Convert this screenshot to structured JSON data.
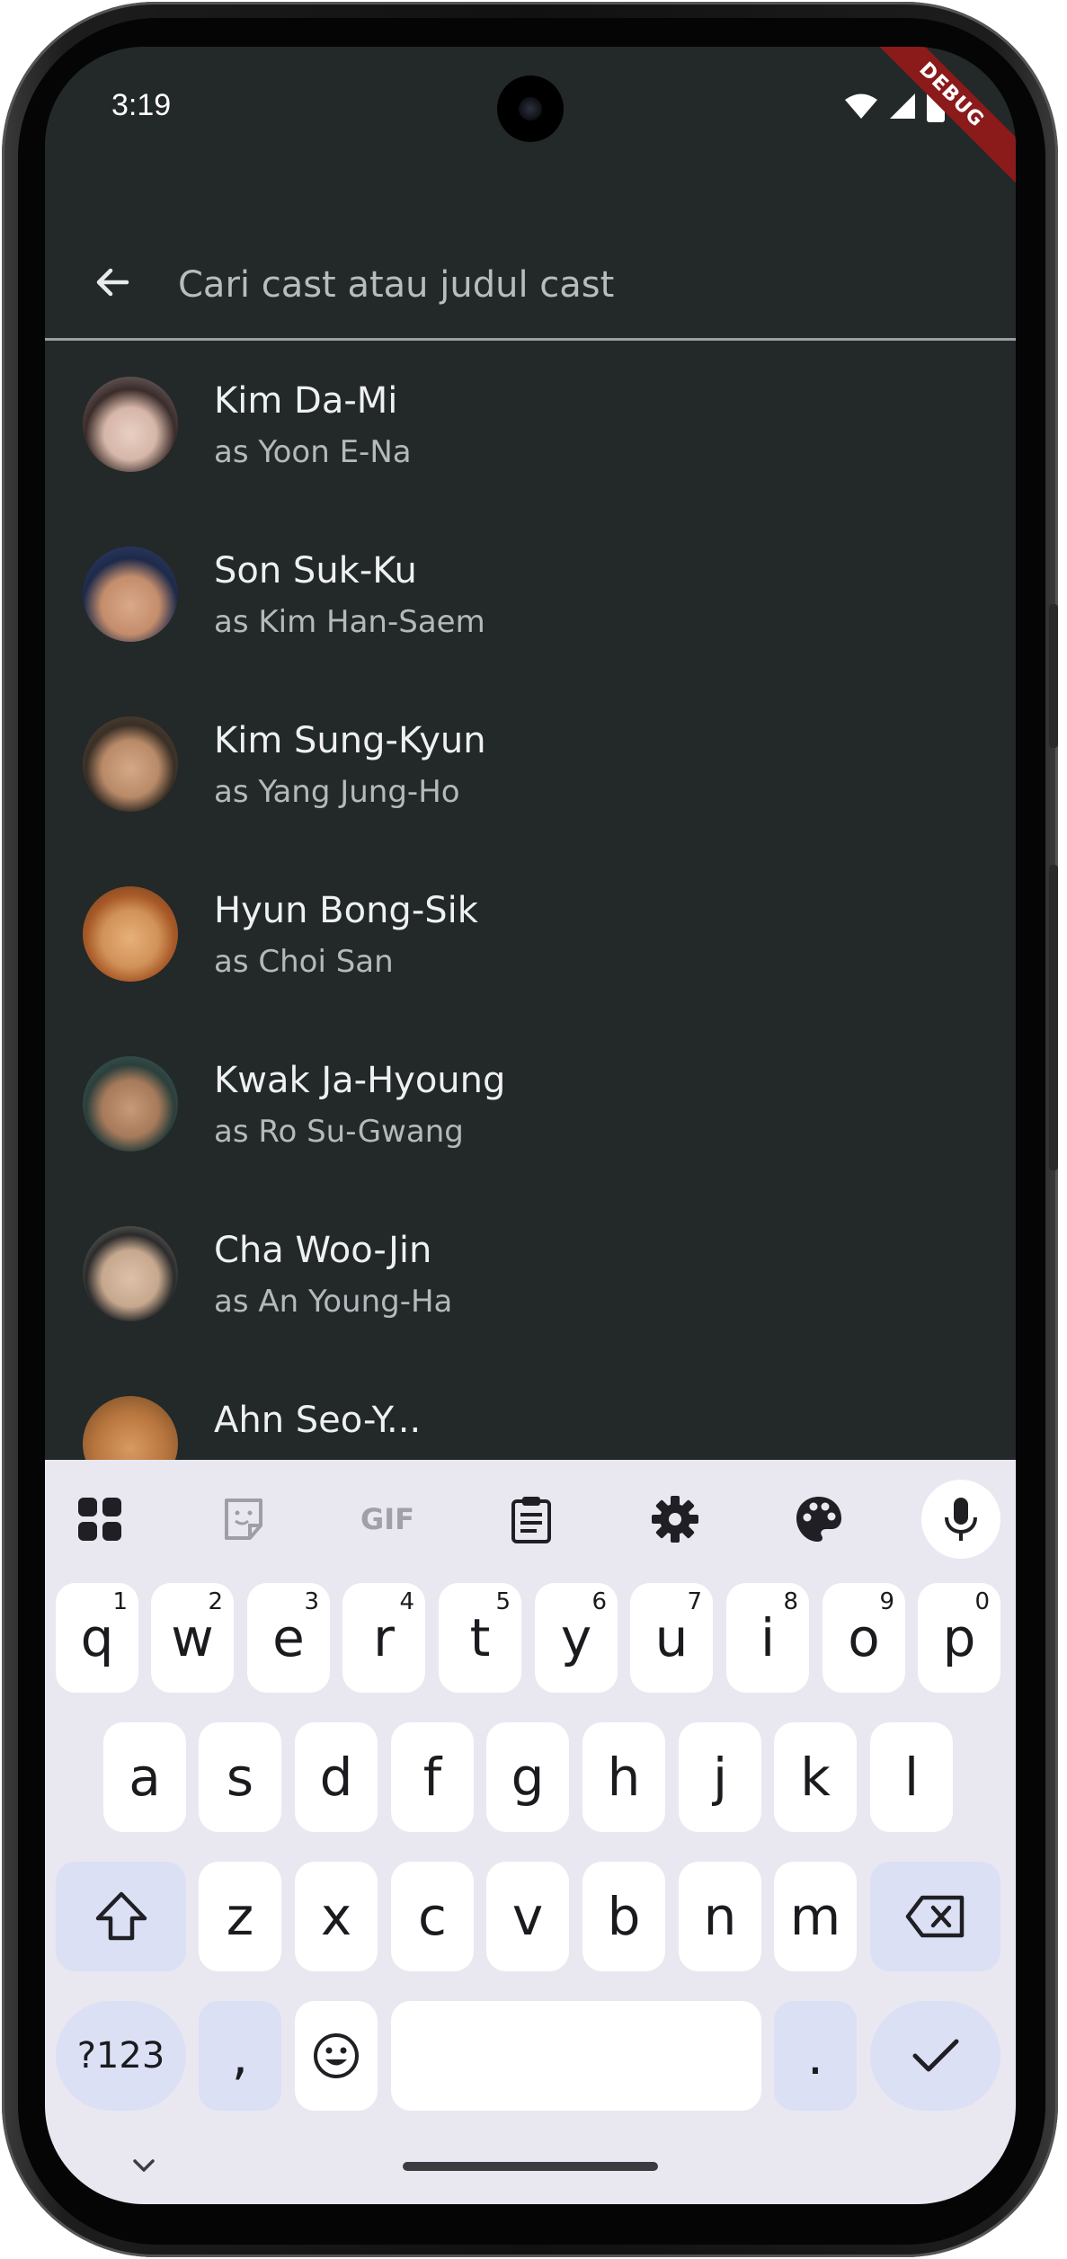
{
  "status_bar": {
    "time": "3:19",
    "icons": [
      "wifi-icon",
      "signal-icon",
      "battery-icon"
    ],
    "debug_label": "DEBUG"
  },
  "search": {
    "placeholder": "Cari cast atau judul cast",
    "value": ""
  },
  "cast": [
    {
      "name": "Kim Da-Mi",
      "role": "as Yoon E-Na",
      "avatar_color": "#6b5a55"
    },
    {
      "name": "Son Suk-Ku",
      "role": "as Kim Han-Saem",
      "avatar_color": "#2f3a57"
    },
    {
      "name": "Kim Sung-Kyun",
      "role": "as Yang Jung-Ho",
      "avatar_color": "#7a6448"
    },
    {
      "name": "Hyun Bong-Sik",
      "role": "as Choi San",
      "avatar_color": "#b07a3a"
    },
    {
      "name": "Kwak Ja-Hyoung",
      "role": "as Ro Su-Gwang",
      "avatar_color": "#3e5a5a"
    },
    {
      "name": "Cha Woo-Jin",
      "role": "as An Young-Ha",
      "avatar_color": "#6e7068"
    },
    {
      "name": "Ahn Seo-Y...",
      "role": "",
      "avatar_color": "#9a6a3a"
    }
  ],
  "keyboard": {
    "toolbar": [
      "apps-icon",
      "sticker-icon",
      "gif-icon",
      "clipboard-icon",
      "settings-icon",
      "palette-icon",
      "mic-icon"
    ],
    "gif_label": "GIF",
    "row1": [
      {
        "k": "q",
        "h": "1"
      },
      {
        "k": "w",
        "h": "2"
      },
      {
        "k": "e",
        "h": "3"
      },
      {
        "k": "r",
        "h": "4"
      },
      {
        "k": "t",
        "h": "5"
      },
      {
        "k": "y",
        "h": "6"
      },
      {
        "k": "u",
        "h": "7"
      },
      {
        "k": "i",
        "h": "8"
      },
      {
        "k": "o",
        "h": "9"
      },
      {
        "k": "p",
        "h": "0"
      }
    ],
    "row2": [
      "a",
      "s",
      "d",
      "f",
      "g",
      "h",
      "j",
      "k",
      "l"
    ],
    "row3": [
      "z",
      "x",
      "c",
      "v",
      "b",
      "n",
      "m"
    ],
    "symbols_label": "?123",
    "comma": ",",
    "period": ".",
    "colors": {
      "key": "#ffffff",
      "modifier": "#dbe0f5",
      "background": "#e9e8f1"
    }
  },
  "colors": {
    "app_background": "#232829",
    "text_primary": "#eef0f1",
    "text_secondary": "#b4b9bb"
  }
}
